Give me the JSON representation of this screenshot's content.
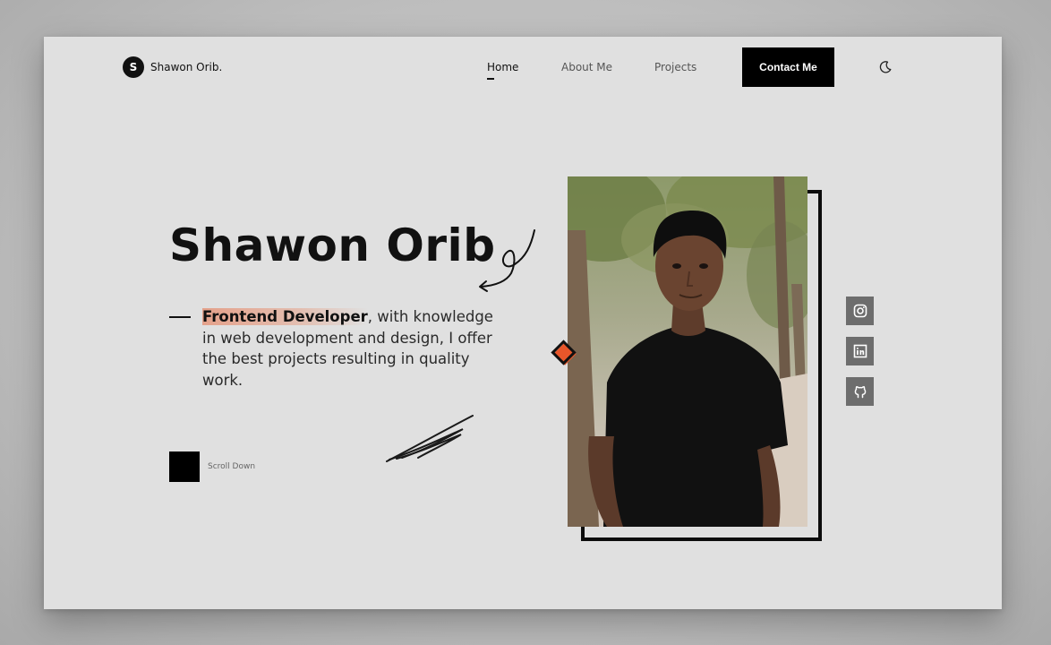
{
  "header": {
    "logo_letter": "S",
    "logo_text": "Shawon Orib.",
    "nav": [
      "Home",
      "About Me",
      "Projects"
    ],
    "active": "Home",
    "contact_label": "Contact Me",
    "theme_icon": "moon-icon"
  },
  "hero": {
    "title": "Shawon Orib",
    "role": "Frontend Developer",
    "description": ", with knowledge in web development and design, I offer the best projects resulting in quality work.",
    "scroll_label": "Scroll Down"
  },
  "social": [
    "instagram-icon",
    "linkedin-icon",
    "github-icon"
  ],
  "colors": {
    "page": "#e0e0e0",
    "dark": "#000000",
    "accent": "#e8562a",
    "social_bg": "#6d6d6d"
  }
}
